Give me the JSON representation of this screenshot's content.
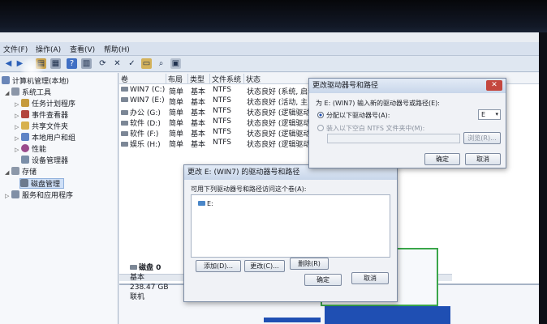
{
  "menu": {
    "file": "文件(F)",
    "action": "操作(A)",
    "view": "查看(V)",
    "help": "帮助(H)"
  },
  "tree": {
    "root": "计算机管理(本地)",
    "system_tools": "系统工具",
    "task_scheduler": "任务计划程序",
    "event_viewer": "事件查看器",
    "shared_folders": "共享文件夹",
    "local_users": "本地用户和组",
    "performance": "性能",
    "device_manager": "设备管理器",
    "storage": "存储",
    "disk_management": "磁盘管理",
    "services": "服务和应用程序"
  },
  "volumes": {
    "headers": [
      "卷",
      "布局",
      "类型",
      "文件系统",
      "状态"
    ],
    "rows": [
      {
        "name": "WIN7 (C:)",
        "layout": "简单",
        "type": "基本",
        "fs": "NTFS",
        "status": "状态良好 (系统, 启动"
      },
      {
        "name": "WIN7 (E:)",
        "layout": "简单",
        "type": "基本",
        "fs": "NTFS",
        "status": "状态良好 (活动, 主"
      },
      {
        "name": "办公 (G:)",
        "layout": "简单",
        "type": "基本",
        "fs": "NTFS",
        "status": "状态良好 (逻辑驱动"
      },
      {
        "name": "软件 (D:)",
        "layout": "简单",
        "type": "基本",
        "fs": "NTFS",
        "status": "状态良好 (逻辑驱动"
      },
      {
        "name": "软件 (F:)",
        "layout": "简单",
        "type": "基本",
        "fs": "NTFS",
        "status": "状态良好 (逻辑驱动"
      },
      {
        "name": "娱乐 (H:)",
        "layout": "简单",
        "type": "基本",
        "fs": "NTFS",
        "status": "状态良好 (逻辑驱动"
      }
    ]
  },
  "disk": {
    "name": "磁盘 0",
    "type": "基本",
    "size": "238.47 GB",
    "state": "联机"
  },
  "dialog_change": {
    "title": "更改 E: (WIN7) 的驱动器号和路径",
    "prompt": "可用下列驱动器号和路径访问这个卷(A):",
    "item": "E:",
    "add": "添加(D)...",
    "change": "更改(C)...",
    "remove": "删除(R)",
    "ok": "确定",
    "cancel": "取消"
  },
  "dialog_assign": {
    "title": "更改驱动器号和路径",
    "prompt": "为 E: (WIN7) 输入新的驱动器号或路径(E):",
    "option_letter": "分配以下驱动器号(A):",
    "letter_value": "E",
    "option_folder": "装入以下空白 NTFS 文件夹中(M):",
    "browse": "浏览(R)...",
    "ok": "确定",
    "cancel": "取消"
  },
  "colors": {
    "partition_bar": "#1f4fb3",
    "selection": "#cfe0f7"
  }
}
